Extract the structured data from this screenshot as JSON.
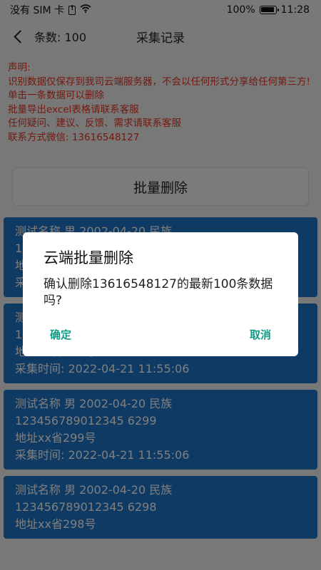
{
  "statusbar": {
    "carrier": "没有 SIM 卡",
    "battery": "100%",
    "time": "11:28"
  },
  "navbar": {
    "count_label": "条数: 100",
    "title": "采集记录"
  },
  "notice": {
    "lines": [
      "声明:",
      "识别数据仅保存到我司云端服务器，不会以任何形式分享给任何第三方!",
      "单击一条数据可以删除",
      "批量导出excel表格请联系客服",
      "任何疑问、建议、反馈、需求请联系客服",
      "联系方式微信: 13616548127"
    ]
  },
  "batch_delete_label": "批量删除",
  "records": [
    {
      "line1": "测试名称  男  2002-04-20  民族",
      "line2": "1",
      "line3": "地",
      "line4": "采"
    },
    {
      "line1": "测",
      "line2": "1",
      "line3": "地址xx省300号",
      "line4": "采集时间:  2022-04-21 11:55:06"
    },
    {
      "line1": "测试名称  男  2002-04-20  民族",
      "line2": "123456789012345 6299",
      "line3": "地址xx省299号",
      "line4": "采集时间:  2022-04-21 11:55:06"
    },
    {
      "line1": "测试名称  男  2002-04-20  民族",
      "line2": "123456789012345 6298",
      "line3": "地址xx省298号",
      "line4": ""
    }
  ],
  "dialog": {
    "title": "云端批量删除",
    "message": "确认删除13616548127的最新100条数据吗?",
    "confirm_label": "确定",
    "cancel_label": "取消"
  },
  "colors": {
    "notice_red": "#e8331f",
    "card_blue": "#1f74c7",
    "dialog_button_teal": "#0f9b86"
  },
  "icons": [
    "sim-warning-icon",
    "wifi-icon",
    "battery-icon",
    "back-arrow-icon"
  ]
}
